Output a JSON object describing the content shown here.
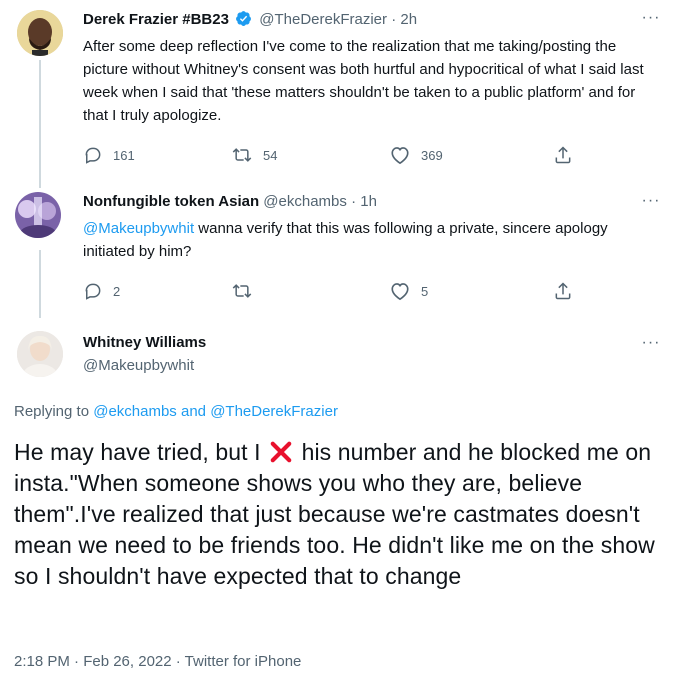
{
  "tweets": [
    {
      "name": "Derek Frazier #BB23",
      "handle": "@TheDerekFrazier",
      "time": "· 2h",
      "verified": true,
      "text": "After some deep reflection I've come to the realization that me taking/posting the picture without Whitney's consent was both hurtful and hypocritical of what I said last week when I said that 'these matters shouldn't be taken to a public platform' and for that I truly apologize.",
      "replies": "161",
      "retweets": "54",
      "likes": "369"
    },
    {
      "name": "Nonfungible token Asian",
      "handle": "@ekchambs",
      "time": "· 1h",
      "mention": "@Makeupbywhit",
      "text": " wanna verify that this was following a private, sincere apology initiated by him?",
      "replies": "2",
      "retweets": "",
      "likes": "5"
    }
  ],
  "main_tweet": {
    "name": "Whitney Williams",
    "handle": "@Makeupbywhit",
    "replying_prefix": "Replying to",
    "replying_to_1": "@ekchambs",
    "replying_and": "and",
    "replying_to_2": "@TheDerekFrazier",
    "text_before_emoji": "He may have tried, but I",
    "text_after_emoji": " his number and he blocked me on insta.\"When someone shows you who they are, believe them\".I've realized that just because we're castmates doesn't mean we need to be friends too. He didn't like me on the show so I shouldn't have expected that to change",
    "emoji": "cross-mark-icon",
    "timestamp": "2:18 PM · Feb 26, 2022 · Twitter for iPhone"
  },
  "colors": {
    "accent": "#1d9bf0",
    "secondary_text": "#536471",
    "cross": "#e8112d"
  }
}
